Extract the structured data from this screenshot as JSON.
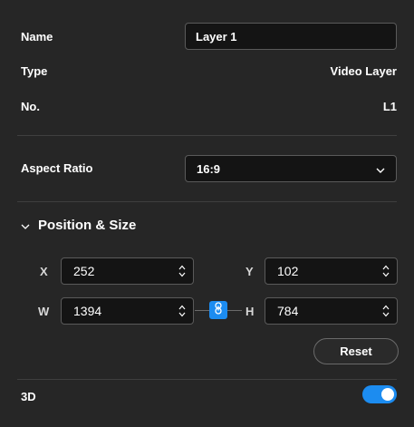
{
  "properties": {
    "name_label": "Name",
    "name_value": "Layer 1",
    "type_label": "Type",
    "type_value": "Video Layer",
    "no_label": "No.",
    "no_value": "L1"
  },
  "aspect_ratio": {
    "label": "Aspect Ratio",
    "selected": "16:9"
  },
  "position_size": {
    "title": "Position & Size",
    "x_label": "X",
    "x_value": "252",
    "y_label": "Y",
    "y_value": "102",
    "w_label": "W",
    "w_value": "1394",
    "h_label": "H",
    "h_value": "784",
    "link_enabled": true,
    "reset_label": "Reset"
  },
  "three_d": {
    "label": "3D",
    "enabled": true
  },
  "colors": {
    "background": "#262626",
    "field_bg": "#141414",
    "accent": "#1c8cf0"
  },
  "icons": [
    "chevron-down-icon",
    "spinner-arrows-icon",
    "link-icon",
    "toggle-switch"
  ]
}
